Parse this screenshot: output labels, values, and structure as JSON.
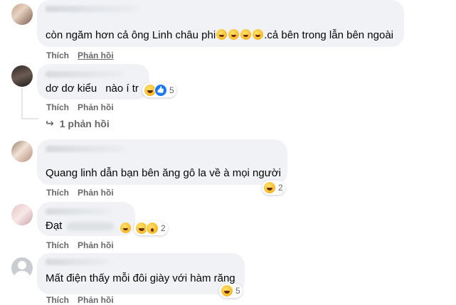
{
  "comments": [
    {
      "text": "còn ngăm hơn cả ông Linh châu phi",
      "text_suffix": ".cả bên trong lẫn bên ngoài",
      "inline_emoji": [
        "rolling-laugh-emoji",
        "rolling-laugh-emoji",
        "rolling-laugh-emoji",
        "rolling-laugh-emoji"
      ],
      "actions": {
        "like": "Thích",
        "reply": "Phản hồi"
      }
    },
    {
      "text_a": "dơ dơ kiểu",
      "text_b": "nào í tr",
      "reactions": {
        "icons": [
          "haha-icon",
          "like-icon"
        ],
        "count": "5"
      },
      "actions": {
        "like": "Thích",
        "reply": "Phản hồi"
      },
      "replies_label": "1 phản hồi"
    },
    {
      "text": "Quang linh dẫn bạn bên ăng gô la về à mọi người",
      "reactions": {
        "icons": [
          "haha-icon"
        ],
        "count": "2"
      },
      "actions": {
        "like": "Thích",
        "reply": "Phản hồi"
      }
    },
    {
      "text": "Đạt",
      "inline_emoji": [
        "laugh-emoji"
      ],
      "reactions": {
        "icons": [
          "haha-icon",
          "wow-icon"
        ],
        "count": "2"
      },
      "actions": {
        "like": "Thích",
        "reply": "Phản hồi"
      }
    },
    {
      "text": "Mất điện thấy mỗi đôi giày với hàm răng",
      "reactions": {
        "icons": [
          "haha-icon"
        ],
        "count": "5"
      },
      "actions": {
        "like": "Thích",
        "reply": "Phản hồi"
      }
    }
  ]
}
